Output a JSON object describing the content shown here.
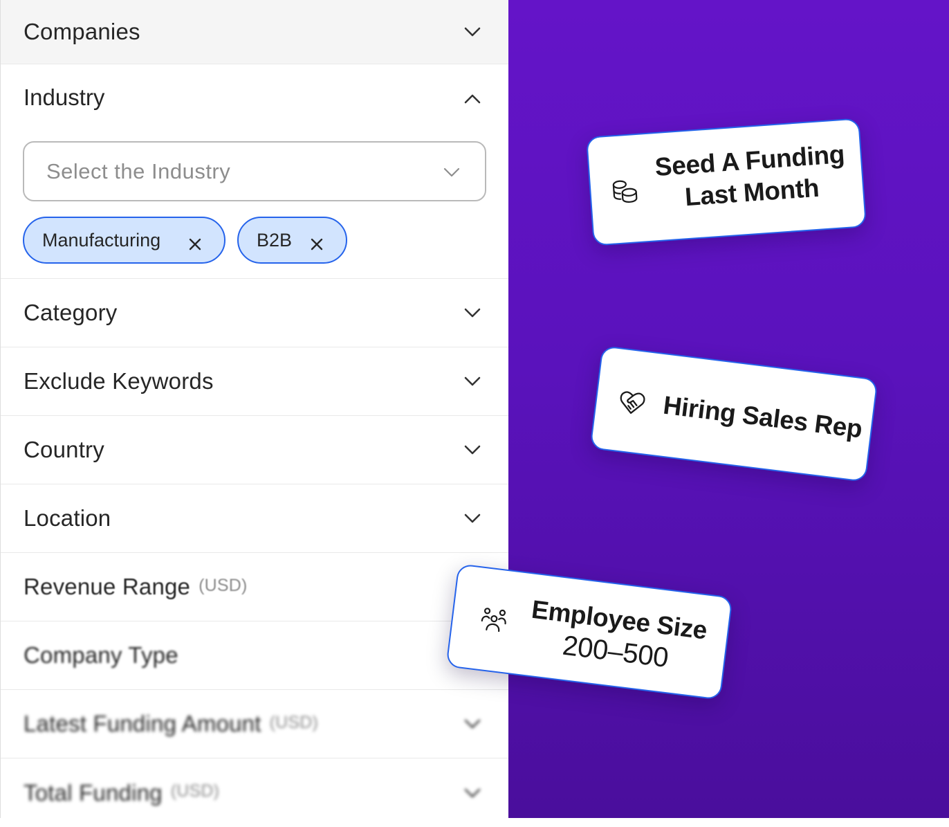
{
  "filters": {
    "companies": {
      "label": "Companies"
    },
    "industry": {
      "label": "Industry",
      "select_placeholder": "Select the Industry",
      "chips": [
        {
          "label": "Manufacturing"
        },
        {
          "label": "B2B"
        }
      ]
    },
    "category": {
      "label": "Category"
    },
    "exclude_keywords": {
      "label": "Exclude Keywords"
    },
    "country": {
      "label": "Country"
    },
    "location": {
      "label": "Location"
    },
    "revenue_range": {
      "label": "Revenue Range",
      "unit": "(USD)"
    },
    "company_type": {
      "label": "Company Type"
    },
    "latest_funding_amount": {
      "label": "Latest Funding Amount",
      "unit": "(USD)"
    },
    "total_funding": {
      "label": "Total Funding",
      "unit": "(USD)"
    }
  },
  "cards": {
    "seed_funding": {
      "line1": "Seed A Funding",
      "line2": "Last Month",
      "icon": "coins-icon"
    },
    "hiring": {
      "line1": "Hiring Sales Rep",
      "icon": "heart-handshake-icon"
    },
    "employee_size": {
      "line1": "Employee Size",
      "line2": "200–500",
      "icon": "team-icon"
    }
  },
  "colors": {
    "accent_blue": "#2563eb",
    "chip_fill": "#d2e4fe",
    "panel_purple": "#5a12bc"
  }
}
